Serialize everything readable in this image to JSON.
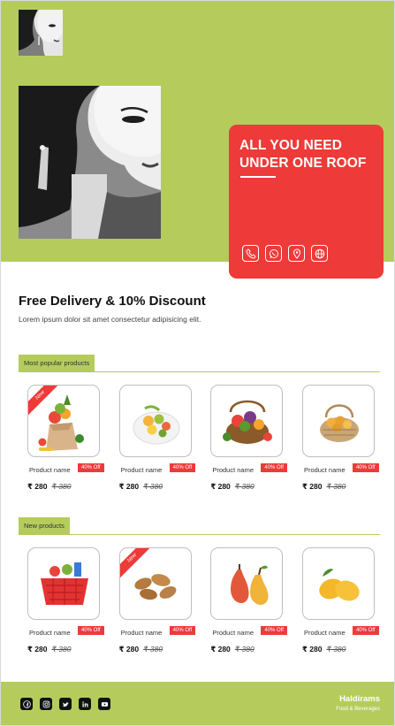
{
  "hero": {
    "promo_title": "ALL YOU NEED UNDER ONE ROOF",
    "contact_icons": [
      "phone-icon",
      "whatsapp-icon",
      "location-pin-icon",
      "globe-icon"
    ]
  },
  "intro": {
    "headline": "Free Delivery & 10% Discount",
    "subline": "Lorem ipsum dolor sit amet consectetur adipisicing elit."
  },
  "sections": [
    {
      "label": "Most popular products",
      "products": [
        {
          "name": "Product name",
          "discount": "40% Off",
          "price": "₹ 280",
          "old_price": "₹ 380",
          "badge": "New",
          "icon": "grocery-bag-icon"
        },
        {
          "name": "Product name",
          "discount": "40% Off",
          "price": "₹ 280",
          "old_price": "₹ 380",
          "badge": "",
          "icon": "fruit-bowl-icon"
        },
        {
          "name": "Product name",
          "discount": "40% Off",
          "price": "₹ 280",
          "old_price": "₹ 380",
          "badge": "",
          "icon": "vegetable-basket-icon"
        },
        {
          "name": "Product name",
          "discount": "40% Off",
          "price": "₹ 280",
          "old_price": "₹ 380",
          "badge": "",
          "icon": "wicker-basket-icon"
        }
      ]
    },
    {
      "label": "New products",
      "products": [
        {
          "name": "Product name",
          "discount": "40% Off",
          "price": "₹ 280",
          "old_price": "₹ 380",
          "badge": "",
          "icon": "shopping-basket-icon"
        },
        {
          "name": "Product name",
          "discount": "40% Off",
          "price": "₹ 280",
          "old_price": "₹ 380",
          "badge": "New",
          "icon": "almonds-icon"
        },
        {
          "name": "Product name",
          "discount": "40% Off",
          "price": "₹ 280",
          "old_price": "₹ 380",
          "badge": "",
          "icon": "pears-icon"
        },
        {
          "name": "Product name",
          "discount": "40% Off",
          "price": "₹ 280",
          "old_price": "₹ 380",
          "badge": "",
          "icon": "mangoes-icon"
        }
      ]
    }
  ],
  "footer": {
    "brand_name": "Haldirams",
    "brand_tagline": "Food & Beverages",
    "social_icons": [
      "facebook-icon",
      "instagram-icon",
      "twitter-icon",
      "linkedin-icon",
      "youtube-icon"
    ]
  },
  "colors": {
    "accent_green": "#b5cc5c",
    "accent_red": "#ee3a38"
  }
}
